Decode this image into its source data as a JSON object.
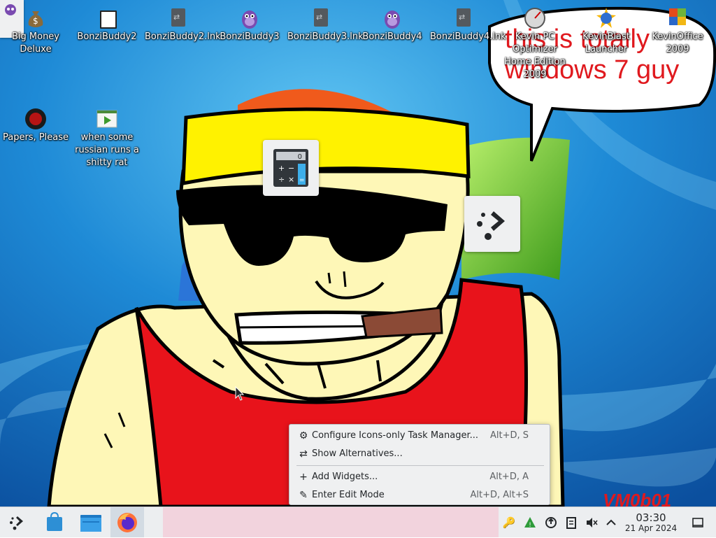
{
  "wallpaper": {
    "speech_bubble_text_line1": "this is totally",
    "speech_bubble_text_line2": "windows 7 guy",
    "signature": "VM0b01"
  },
  "desktop_icons": [
    {
      "label": "Big Money Deluxe",
      "icon": "money-bag-icon"
    },
    {
      "label": "BonziBuddy2",
      "icon": "folder-icon"
    },
    {
      "label": "BonziBuddy2.lnk",
      "icon": "shortcut-file-icon"
    },
    {
      "label": "BonziBuddy3",
      "icon": "bonzi-gorilla-icon"
    },
    {
      "label": "BonziBuddy3.lnk",
      "icon": "shortcut-file-icon"
    },
    {
      "label": "BonziBuddy4",
      "icon": "bonzi-gorilla-icon"
    },
    {
      "label": "BonziBuddy4.lnk",
      "icon": "shortcut-file-icon"
    },
    {
      "label": "Kevin PC Optimizer Home Edition 2009",
      "icon": "speedometer-icon"
    },
    {
      "label": "KevinBlast Launcher",
      "icon": "globe-icon"
    },
    {
      "label": "KevinOffice 2009",
      "icon": "office-icon"
    },
    {
      "label": "Papers, Please",
      "icon": "seal-icon"
    },
    {
      "label": "when some russian runs a shitty rat",
      "icon": "video-file-icon"
    }
  ],
  "widgets": {
    "calculator_display": "0",
    "calculator_keys": [
      "+",
      "−",
      "÷",
      "×",
      "="
    ]
  },
  "context_menu": {
    "items": [
      {
        "label": "Configure Icons-only Task Manager...",
        "shortcut": "Alt+D, S",
        "icon": "configure-icon"
      },
      {
        "label": "Show Alternatives...",
        "shortcut": "",
        "icon": "alternatives-icon"
      },
      {
        "label": "Add Widgets...",
        "shortcut": "Alt+D, A",
        "icon": "plus-icon"
      },
      {
        "label": "Enter Edit Mode",
        "shortcut": "Alt+D, Alt+S",
        "icon": "pencil-icon"
      }
    ]
  },
  "taskbar": {
    "apps": [
      {
        "name": "Application Launcher",
        "icon": "kde-launcher-icon"
      },
      {
        "name": "Discover",
        "icon": "discover-store-icon"
      },
      {
        "name": "Dolphin",
        "icon": "folder-manager-icon"
      },
      {
        "name": "Firefox",
        "icon": "firefox-icon"
      }
    ],
    "tray_icons": [
      "network-icon",
      "updates-icon",
      "vpn-icon",
      "clipboard-icon",
      "muted-volume-icon",
      "expand-tray-icon"
    ],
    "clock_time": "03:30",
    "clock_date": "21 Apr 2024",
    "show_desktop_icon": "show-desktop-icon"
  },
  "colors": {
    "panel_bg": "#eceef0",
    "wallpaper_blue": "#1e8ad6",
    "speech_text_red": "#e0191e",
    "shirt_red": "#e8131b",
    "headband_yellow": "#fff200",
    "skin": "#fef7b7"
  }
}
